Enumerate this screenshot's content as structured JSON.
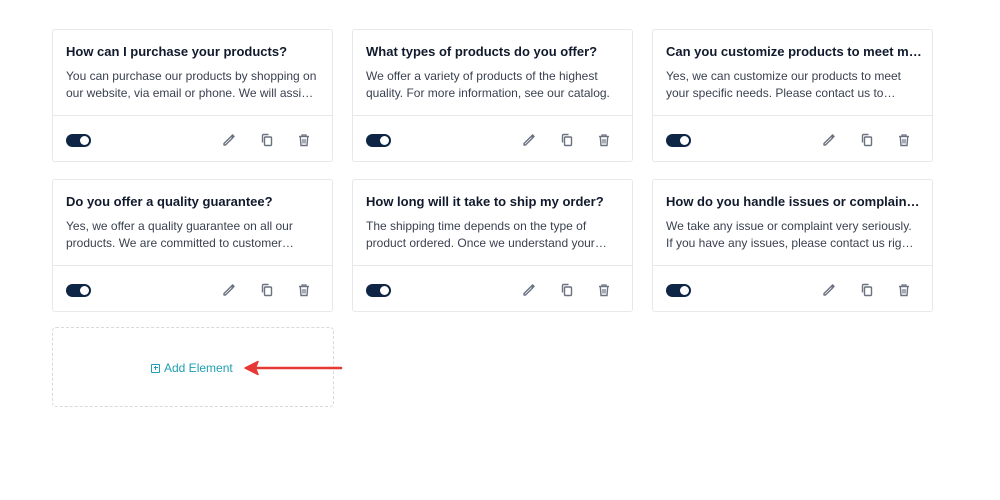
{
  "cards": [
    {
      "title": "How can I purchase your products?",
      "body": "You can purchase our products by shopping on our website, via email or phone. We will assist you with your order."
    },
    {
      "title": "What types of products do you offer?",
      "body": "We offer a variety of products of the highest quality. For more information, see our catalog."
    },
    {
      "title": "Can you customize products to meet my specific needs?",
      "body": "Yes, we can customize our products to meet your specific needs. Please contact us to discuss your requirements."
    },
    {
      "title": "Do you offer a quality guarantee?",
      "body": "Yes, we offer a quality guarantee on all our products. We are committed to customer satisfaction."
    },
    {
      "title": "How long will it take to ship my order?",
      "body": "The shipping time depends on the type of product ordered. Once we understand your order, we will let you know."
    },
    {
      "title": "How do you handle issues or complaints?",
      "body": "We take any issue or complaint very seriously. If you have any issues, please contact us right away."
    }
  ],
  "add_element": {
    "label": "Add Element"
  },
  "colors": {
    "toggle": "#0f2545",
    "accent": "#1e9fb3",
    "annotation_arrow": "#e53935"
  }
}
